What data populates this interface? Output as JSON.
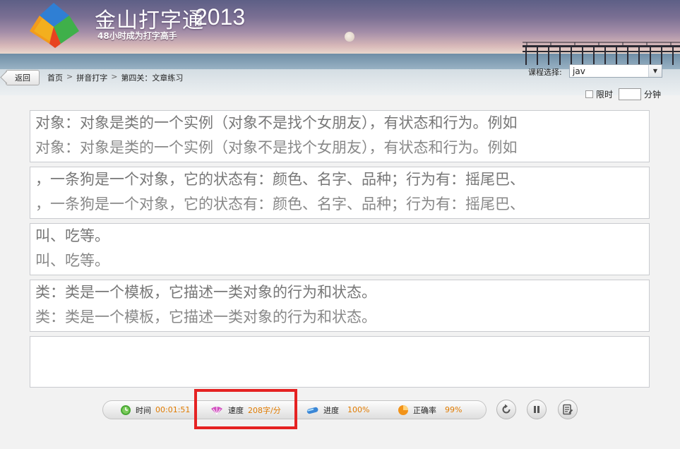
{
  "header": {
    "app_name": "金山打字通",
    "year": "2013",
    "slogan": "48小时成为打字高手"
  },
  "nav": {
    "back_label": "返回",
    "breadcrumb": [
      "首页",
      "拼音打字",
      "第四关：文章练习"
    ],
    "separator": ">",
    "course_label": "课程选择:",
    "course_value": "jav",
    "limit_label": "限时",
    "limit_checked": false,
    "limit_minutes": "",
    "minutes_unit": "分钟"
  },
  "exercise": {
    "rows": [
      {
        "source": "对象：对象是类的一个实例（对象不是找个女朋友），有状态和行为。例如",
        "typed": "对象：对象是类的一个实例（对象不是找个女朋友），有状态和行为。例如"
      },
      {
        "source": "，一条狗是一个对象，它的状态有：颜色、名字、品种；行为有：摇尾巴、",
        "typed": "，一条狗是一个对象，它的状态有：颜色、名字、品种；行为有：摇尾巴、"
      },
      {
        "source": "叫、吃等。",
        "typed": "叫、吃等。"
      },
      {
        "source": "类：类是一个模板，它描述一类对象的行为和状态。",
        "typed": "类：类是一个模板，它描述一类对象的行为和状态。"
      },
      {
        "source": "",
        "typed": ""
      }
    ]
  },
  "status": {
    "time_label": "时间",
    "time_value": "00:01:51",
    "speed_label": "速度",
    "speed_value": "208字/分",
    "progress_label": "进度",
    "progress_value": "100%",
    "accuracy_label": "正确率",
    "accuracy_value": "99%"
  },
  "controls": {
    "icons": [
      "restart-icon",
      "pause-icon",
      "report-icon"
    ]
  },
  "colors": {
    "value_text": "#e07b00",
    "highlight": "#e52222"
  }
}
